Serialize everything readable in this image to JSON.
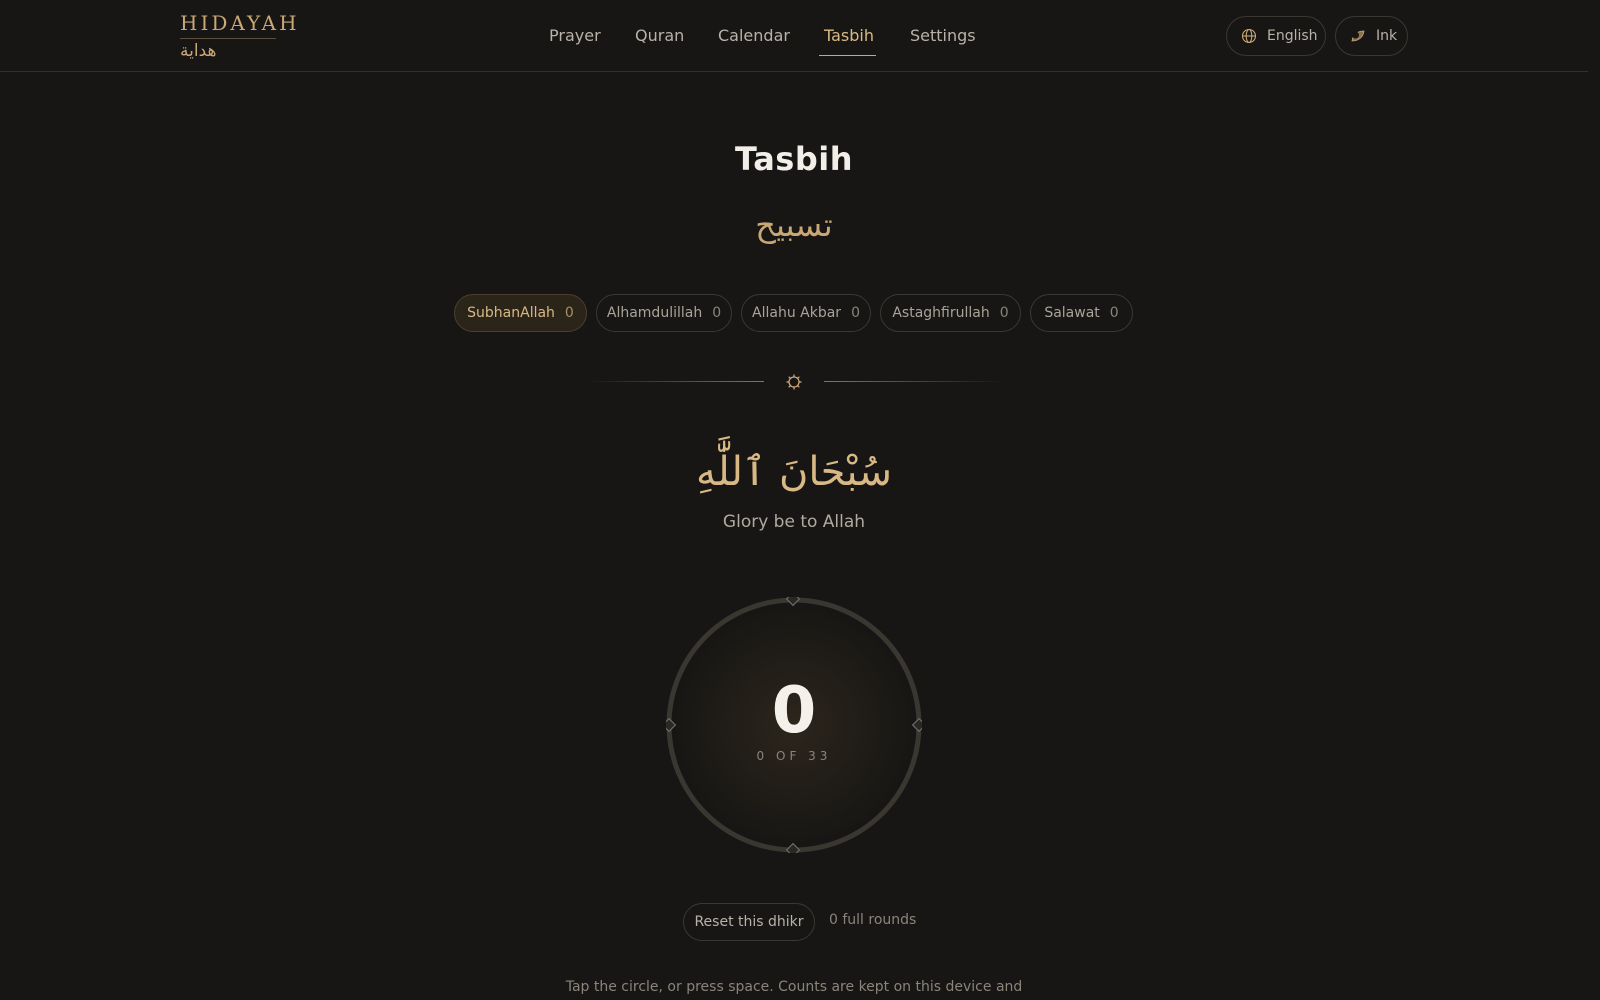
{
  "header": {
    "logo_en": "HIDAYAH",
    "logo_ar": "هداية",
    "nav": [
      {
        "label": "Prayer"
      },
      {
        "label": "Quran"
      },
      {
        "label": "Calendar"
      },
      {
        "label": "Tasbih",
        "active": true
      },
      {
        "label": "Settings"
      }
    ],
    "language_label": "English",
    "language_icon": "globe-icon",
    "theme_label": "Ink",
    "theme_icon": "leaf-icon"
  },
  "page": {
    "title": "Tasbih",
    "title_ar": "تسبيح"
  },
  "dhikrs": [
    {
      "label": "SubhanAllah",
      "count": "0",
      "active": true
    },
    {
      "label": "Alhamdulillah",
      "count": "0"
    },
    {
      "label": "Allahu Akbar",
      "count": "0"
    },
    {
      "label": "Astaghfirullah",
      "count": "0"
    },
    {
      "label": "Salawat",
      "count": "0"
    }
  ],
  "current": {
    "arabic": "سُبْحَانَ ٱللَّٰهِ",
    "translation": "Glory be to Allah",
    "count": "0",
    "progress_text": "0 OF 33",
    "progress_fraction": 0
  },
  "controls": {
    "reset_label": "Reset this dhikr",
    "rounds_text": "0 full rounds"
  },
  "footnote": "Tap the circle, or press space. Counts are kept on this device and",
  "colors": {
    "background": "#171614",
    "accent": "#c9a876",
    "text": "#e8e4dc",
    "muted": "#8a847a"
  }
}
